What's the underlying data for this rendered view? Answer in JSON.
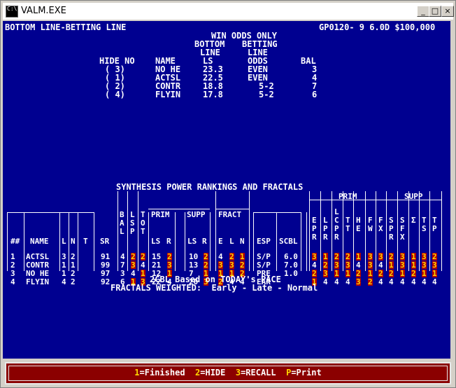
{
  "window": {
    "title": "VALM.EXE",
    "icon_text": "C:\\",
    "minimize": "_",
    "maximize": "□",
    "close": "×"
  },
  "header": {
    "left": "BOTTOM LINE-BETTING LINE",
    "right": "GP0120- 9 6.0D $100,000"
  },
  "odds": {
    "title": "WIN ODDS ONLY",
    "col_bottom": [
      "BOTTOM",
      "LINE"
    ],
    "col_betting": [
      "BETTING",
      "LINE"
    ],
    "headers": {
      "hide": "HIDE NO",
      "name": "NAME",
      "ls": "LS",
      "odds": "ODDS",
      "bal": "BAL"
    },
    "rows": [
      {
        "no": "( 3)",
        "name": "NO HE",
        "ls": "23.3",
        "odds": "EVEN",
        "bal": "3"
      },
      {
        "no": "( 1)",
        "name": "ACTSL",
        "ls": "22.5",
        "odds": "EVEN",
        "bal": "4"
      },
      {
        "no": "( 2)",
        "name": "CONTR",
        "ls": "18.8",
        "odds": "5-2",
        "bal": "7"
      },
      {
        "no": "( 4)",
        "name": "FLYIN",
        "ls": "17.8",
        "odds": "5-2",
        "bal": "6"
      }
    ]
  },
  "synthesis": {
    "title": "SYNTHESIS POWER RANKINGS AND FRACTALS",
    "group_labels": {
      "prim": "PRIM",
      "supp": "SUPP",
      "fract": "FRACT",
      "prim2": "PRIM",
      "supp2": "SUPP"
    },
    "headers": {
      "num": "##",
      "name": "NAME",
      "l": "L",
      "n": "N",
      "t": "T",
      "sr": "SR",
      "bal": "B\nA\nL",
      "lsp": "L\nS\nP",
      "tot": "T\nO\nT",
      "ls1": "LS",
      "r1": "R",
      "ls2": "LS",
      "r2": "R",
      "e": "E",
      "fl": "L",
      "fn": "N",
      "esp": "ESP",
      "scbl": "SCBL",
      "epr": "E\nP\nR",
      "lpr": "L\nP\nR",
      "cpr": "L\nC\nP\nR",
      "ctt": "C\nT\nT",
      "tt": "T\nT",
      "he": "H\nE",
      "fw": "F\nW",
      "fx": "F\nX",
      "spr": "S\nP\nR",
      "sfx": "S\nF\nX",
      "sig": "Σ",
      "ts": "T\nS",
      "tp": "T\nP"
    },
    "rows": [
      {
        "num": "1",
        "name": "ACTSL",
        "l": "3",
        "n": "2",
        "t": "",
        "sr": "91",
        "bal": "4",
        "lsp": "2",
        "tot": "2",
        "ls1": "15",
        "r1": "2",
        "ls2": "10",
        "r2": "2",
        "e": "4",
        "fl": "2",
        "fn": "1",
        "esp": "S/P",
        "scbl": "6.0",
        "c": [
          "3",
          "1",
          "2",
          "2",
          "1",
          "3",
          "3",
          "2",
          "3",
          "1",
          "3",
          "2"
        ]
      },
      {
        "num": "2",
        "name": "CONTR",
        "l": "1",
        "n": "1",
        "t": "",
        "sr": "99",
        "bal": "7",
        "lsp": "3",
        "tot": "4",
        "ls1": "21",
        "r1": "3",
        "ls2": "13",
        "r2": "2",
        "e": "3",
        "fl": "3",
        "fn": "2",
        "esp": "S/P",
        "scbl": "7.0",
        "c": [
          "4",
          "2",
          "3",
          "3",
          "4",
          "3",
          "4",
          "1",
          "3",
          "1",
          "3",
          "3"
        ]
      },
      {
        "num": "3",
        "name": "NO HE",
        "l": "1",
        "n": "2",
        "t": "",
        "sr": "97",
        "bal": "3",
        "lsp": "4",
        "tot": "1",
        "ls1": "12",
        "r1": "1",
        "ls2": "7",
        "r2": "1",
        "e": "1",
        "fl": "1",
        "fn": "2",
        "esp": "PRE",
        "scbl": "1.0",
        "c": [
          "2",
          "3",
          "1",
          "1",
          "2",
          "1",
          "2",
          "2",
          "1",
          "2",
          "1",
          "1"
        ]
      },
      {
        "num": "4",
        "name": "FLYIN",
        "l": "4",
        "n": "2",
        "t": "",
        "sr": "92",
        "bal": "6",
        "lsp": "1",
        "tot": "3",
        "ls1": "22",
        "r1": "4",
        "ls2": "20",
        "r2": "3",
        "e": "2",
        "fl": "4",
        "fn": "4",
        "esp": "EAR",
        "scbl": "",
        "c": [
          "1",
          "4",
          "4",
          "4",
          "3",
          "2",
          "4",
          "4",
          "4",
          "4",
          "4",
          "4"
        ]
      }
    ]
  },
  "notes": {
    "line1": "2CBL Based on TODAY's PACE",
    "line2": "FRACTALS WEIGHTED:  Early - Late - Normal"
  },
  "footer": {
    "k1": "1",
    "l1": "=Finished",
    "k2": "2",
    "l2": "=HIDE",
    "k3": "3",
    "l3": "=RECALL",
    "k4": "P",
    "l4": "=Print"
  }
}
